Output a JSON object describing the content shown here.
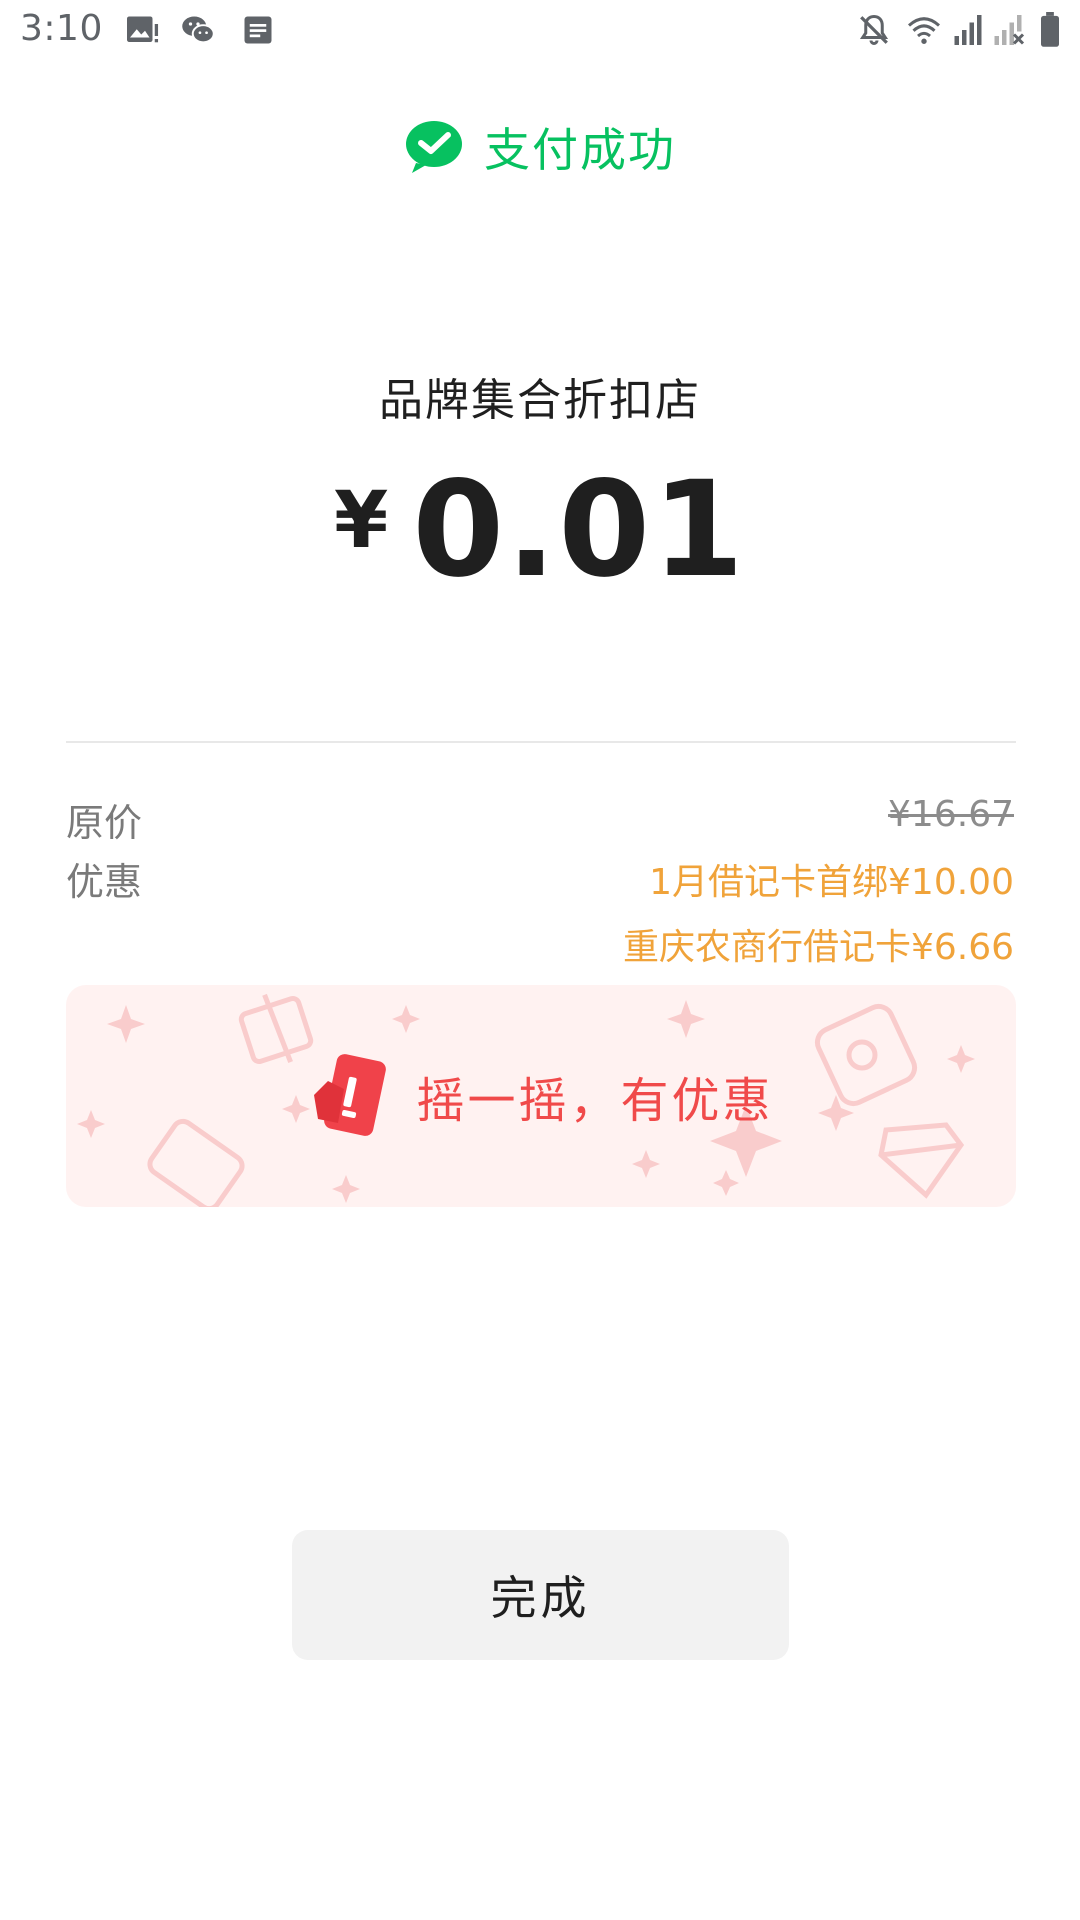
{
  "status_bar": {
    "time": "3:10",
    "left_icons": [
      "gallery-icon",
      "wechat-icon",
      "notes-icon"
    ],
    "right_icons": [
      "bell-off-icon",
      "wifi-icon",
      "signal-icon",
      "signal-no-service-icon",
      "battery-icon"
    ]
  },
  "header": {
    "title": "支付成功",
    "icon": "wechat-pay-icon",
    "accent_color": "#07c160"
  },
  "merchant": {
    "name": "品牌集合折扣店"
  },
  "amount": {
    "currency": "¥",
    "value": "0.01"
  },
  "details": {
    "original_price_label": "原价",
    "original_price_value": "¥16.67",
    "discount_label": "优惠",
    "discounts": [
      "1月借记卡首绑¥10.00",
      "重庆农商行借记卡¥6.66"
    ],
    "discount_color": "#f0a33a"
  },
  "shake_banner": {
    "text": "摇一摇，有优惠",
    "icon": "shake-icon",
    "text_color": "#f04a4a",
    "background_color": "#fff2f1"
  },
  "done_button": {
    "label": "完成"
  }
}
